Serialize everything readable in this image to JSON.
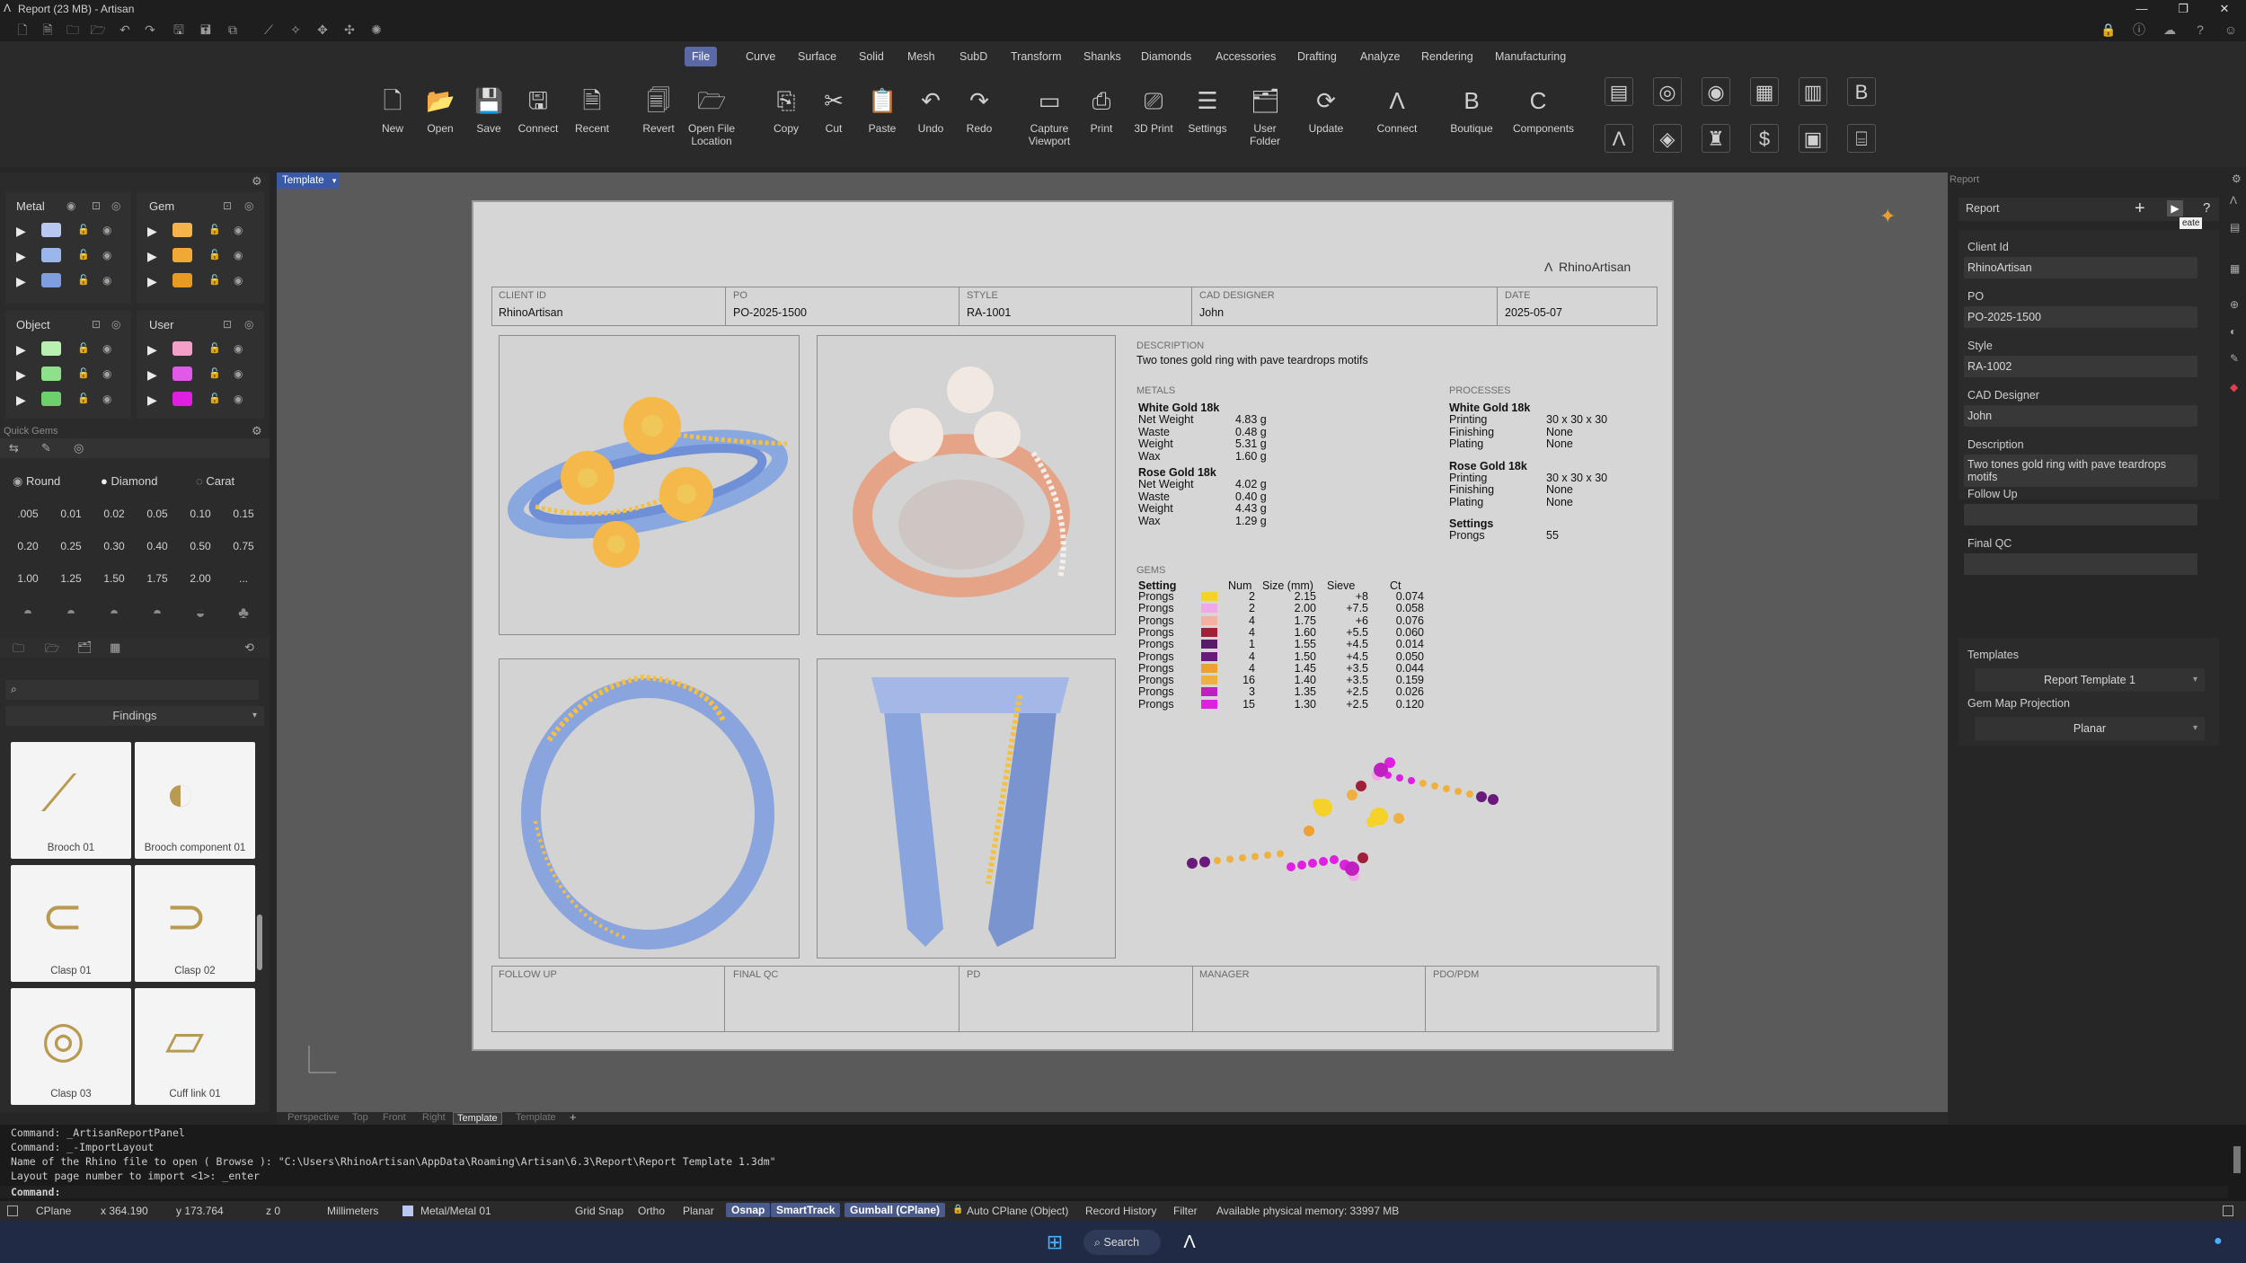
{
  "window": {
    "title": "Report (23 MB) - Artisan",
    "controls": [
      "—",
      "❐",
      "✕"
    ]
  },
  "ribbon": {
    "tabs": [
      "File",
      "Curve",
      "Surface",
      "Solid",
      "Mesh",
      "SubD",
      "Transform",
      "Shanks",
      "Diamonds",
      "Accessories",
      "Drafting",
      "Analyze",
      "Rendering",
      "Manufacturing"
    ],
    "active_tab": "File",
    "buttons": [
      {
        "label": "New",
        "icon": "new-doc-icon",
        "glyph": "🗋"
      },
      {
        "label": "Open",
        "icon": "folder-open-icon",
        "glyph": "📂"
      },
      {
        "label": "Save",
        "icon": "save-icon",
        "glyph": "💾"
      },
      {
        "label": "Connect",
        "icon": "connect-icon",
        "glyph": "🖫"
      },
      {
        "label": "Recent",
        "icon": "recent-icon",
        "glyph": "🗎"
      },
      {
        "label": "Revert",
        "icon": "revert-icon",
        "glyph": "🗐"
      },
      {
        "label": "Open File Location",
        "icon": "folder-location-icon",
        "glyph": "🗁"
      },
      {
        "label": "Copy",
        "icon": "copy-icon",
        "glyph": "⎘"
      },
      {
        "label": "Cut",
        "icon": "scissors-icon",
        "glyph": "✂"
      },
      {
        "label": "Paste",
        "icon": "paste-icon",
        "glyph": "📋"
      },
      {
        "label": "Undo",
        "icon": "undo-icon",
        "glyph": "↶"
      },
      {
        "label": "Redo",
        "icon": "redo-icon",
        "glyph": "↷"
      },
      {
        "label": "Capture Viewport",
        "icon": "capture-icon",
        "glyph": "▭"
      },
      {
        "label": "Print",
        "icon": "printer-icon",
        "glyph": "⎙"
      },
      {
        "label": "3D Print",
        "icon": "3d-printer-icon",
        "glyph": "⎚"
      },
      {
        "label": "Settings",
        "icon": "settings-icon",
        "glyph": "☰"
      },
      {
        "label": "User Folder",
        "icon": "user-folder-icon",
        "glyph": "🗂"
      },
      {
        "label": "Update",
        "icon": "update-icon",
        "glyph": "⟳"
      },
      {
        "label": "Connect",
        "icon": "artisan-connect-icon",
        "glyph": "Λ"
      },
      {
        "label": "Boutique",
        "icon": "boutique-icon",
        "glyph": "B"
      },
      {
        "label": "Components",
        "icon": "components-icon",
        "glyph": "C"
      }
    ]
  },
  "left": {
    "metal_label": "Metal",
    "gem_label": "Gem",
    "object_label": "Object",
    "user_label": "User",
    "metal_colors": [
      "#b9c8f0",
      "#9bb6ea",
      "#7f9ee0"
    ],
    "gem_colors": [
      "#f5b44a",
      "#f0a935",
      "#e89a22"
    ],
    "object_colors": [
      "#b8f0b0",
      "#8fe08a",
      "#6ed06c"
    ],
    "user_colors": [
      "#f3a0c8",
      "#e05ae8",
      "#e020e0"
    ],
    "quick_gems_label": "Quick Gems",
    "gem_types": [
      "Round",
      "Diamond",
      "Carat"
    ],
    "carats": [
      ".005",
      "0.01",
      "0.02",
      "0.05",
      "0.10",
      "0.15",
      "0.20",
      "0.25",
      "0.30",
      "0.40",
      "0.50",
      "0.75",
      "1.00",
      "1.25",
      "1.50",
      "1.75",
      "2.00",
      "..."
    ],
    "library_category": "Findings",
    "library_items": [
      "Brooch 01",
      "Brooch component 01",
      "Clasp 01",
      "Clasp 02",
      "Clasp 03",
      "Cuff link 01"
    ]
  },
  "viewport": {
    "layout_tab": "Template",
    "sheet": {
      "brand": "RhinoArtisan",
      "header": [
        {
          "label": "CLIENT ID",
          "value": "RhinoArtisan"
        },
        {
          "label": "PO",
          "value": "PO-2025-1500"
        },
        {
          "label": "STYLE",
          "value": "RA-1001"
        },
        {
          "label": "CAD DESIGNER",
          "value": "John"
        },
        {
          "label": "DATE",
          "value": "2025-05-07"
        }
      ],
      "description_label": "DESCRIPTION",
      "description": "Two tones gold ring with pave teardrops motifs",
      "metals_label": "METALS",
      "metals": [
        {
          "name": "White Gold 18k",
          "rows": [
            [
              "Net Weight",
              "4.83 g"
            ],
            [
              "Waste",
              "0.48 g"
            ],
            [
              "Weight",
              "5.31 g"
            ],
            [
              "Wax",
              "1.60 g"
            ]
          ]
        },
        {
          "name": "Rose Gold 18k",
          "rows": [
            [
              "Net Weight",
              "4.02 g"
            ],
            [
              "Waste",
              "0.40 g"
            ],
            [
              "Weight",
              "4.43 g"
            ],
            [
              "Wax",
              "1.29 g"
            ]
          ]
        }
      ],
      "processes_label": "PROCESSES",
      "processes": [
        {
          "name": "White Gold 18k",
          "rows": [
            [
              "Printing",
              "30 x 30 x 30"
            ],
            [
              "Finishing",
              "None"
            ],
            [
              "Plating",
              "None"
            ]
          ]
        },
        {
          "name": "Rose Gold 18k",
          "rows": [
            [
              "Printing",
              "30 x 30 x 30"
            ],
            [
              "Finishing",
              "None"
            ],
            [
              "Plating",
              "None"
            ]
          ]
        },
        {
          "name": "Settings",
          "rows": [
            [
              "Prongs",
              "55"
            ]
          ]
        }
      ],
      "gems_label": "GEMS",
      "gem_headers": [
        "Setting",
        "Num",
        "Size (mm)",
        "Sieve",
        "Ct"
      ],
      "gems": [
        {
          "setting": "Prongs",
          "color": "#f4d22a",
          "num": "2",
          "size": "2.15",
          "sieve": "+8",
          "ct": "0.074"
        },
        {
          "setting": "Prongs",
          "color": "#f0a8e8",
          "num": "2",
          "size": "2.00",
          "sieve": "+7.5",
          "ct": "0.058"
        },
        {
          "setting": "Prongs",
          "color": "#f4b0a0",
          "num": "4",
          "size": "1.75",
          "sieve": "+6",
          "ct": "0.076"
        },
        {
          "setting": "Prongs",
          "color": "#a0203a",
          "num": "4",
          "size": "1.60",
          "sieve": "+5.5",
          "ct": "0.060"
        },
        {
          "setting": "Prongs",
          "color": "#5a1a6a",
          "num": "1",
          "size": "1.55",
          "sieve": "+4.5",
          "ct": "0.014"
        },
        {
          "setting": "Prongs",
          "color": "#6a1a7a",
          "num": "4",
          "size": "1.50",
          "sieve": "+4.5",
          "ct": "0.050"
        },
        {
          "setting": "Prongs",
          "color": "#f0a030",
          "num": "4",
          "size": "1.45",
          "sieve": "+3.5",
          "ct": "0.044"
        },
        {
          "setting": "Prongs",
          "color": "#f0b040",
          "num": "16",
          "size": "1.40",
          "sieve": "+3.5",
          "ct": "0.159"
        },
        {
          "setting": "Prongs",
          "color": "#c020c0",
          "num": "3",
          "size": "1.35",
          "sieve": "+2.5",
          "ct": "0.026"
        },
        {
          "setting": "Prongs",
          "color": "#e020e0",
          "num": "15",
          "size": "1.30",
          "sieve": "+2.5",
          "ct": "0.120"
        }
      ],
      "footer": [
        "FOLLOW UP",
        "FINAL QC",
        "PD",
        "MANAGER",
        "PDO/PDM"
      ]
    },
    "bottom_tabs": [
      "Perspective",
      "Top",
      "Front",
      "Right",
      "Template",
      "Template"
    ],
    "active_bottom_tab": "Template"
  },
  "report_panel": {
    "panel_header": "Report",
    "title": "Report",
    "tooltip": "eate",
    "fields": [
      {
        "label": "Client Id",
        "value": "RhinoArtisan"
      },
      {
        "label": "PO",
        "value": "PO-2025-1500"
      },
      {
        "label": "Style",
        "value": "RA-1002"
      },
      {
        "label": "CAD Designer",
        "value": "John"
      },
      {
        "label": "Description",
        "value": "Two tones gold ring with pave teardrops motifs"
      },
      {
        "label": "Follow Up",
        "value": ""
      },
      {
        "label": "Final QC",
        "value": ""
      }
    ],
    "templates_label": "Templates",
    "template_value": "Report Template 1",
    "projection_label": "Gem Map Projection",
    "projection_value": "Planar"
  },
  "command": {
    "history": [
      "Command: _ArtisanReportPanel",
      "Command: _-ImportLayout",
      "Name of the Rhino file to open ( Browse ): \"C:\\Users\\RhinoArtisan\\AppData\\Roaming\\Artisan\\6.3\\Report\\Report Template 1.3dm\"",
      "Layout page number to import <1>: _enter"
    ],
    "prompt": "Command:"
  },
  "status": {
    "cplane": "CPlane",
    "x": "x 364.190",
    "y": "y 173.764",
    "z": "z 0",
    "units": "Millimeters",
    "layer": "Metal/Metal 01",
    "grid_snap": "Grid Snap",
    "ortho": "Ortho",
    "planar": "Planar",
    "osnap": "Osnap",
    "smarttrack": "SmartTrack",
    "gumball": "Gumball (CPlane)",
    "auto_cplane": "Auto CPlane (Object)",
    "record_history": "Record History",
    "filter": "Filter",
    "memory": "Available physical memory: 33997 MB"
  },
  "taskbar": {
    "search": "Search"
  }
}
